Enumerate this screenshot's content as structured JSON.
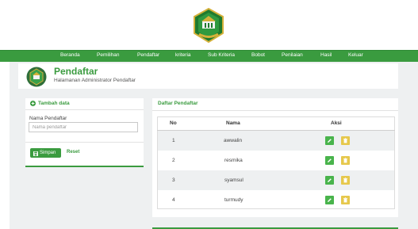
{
  "nav": {
    "items": [
      {
        "label": "Beranda"
      },
      {
        "label": "Pemilihan"
      },
      {
        "label": "Pendaftar"
      },
      {
        "label": "kriteria"
      },
      {
        "label": "Sub Kriteria"
      },
      {
        "label": "Bobot"
      },
      {
        "label": "Penilaian"
      },
      {
        "label": "Hasil"
      },
      {
        "label": "Keluar"
      }
    ]
  },
  "header": {
    "title": "Pendaftar",
    "subtitle": "Halamanan Administrator Pendaftar"
  },
  "form": {
    "heading": "Tambah data",
    "field_label": "Nama Pendaftar",
    "field_placeholder": "Nama pendaftar",
    "field_value": "",
    "save_label": "Simpan",
    "reset_label": "Reset"
  },
  "list": {
    "title": "Daftar Pendaftar",
    "columns": [
      "No",
      "Nama",
      "Aksi"
    ],
    "rows": [
      {
        "no": "1",
        "nama": "awwalin"
      },
      {
        "no": "2",
        "nama": "resmika"
      },
      {
        "no": "3",
        "nama": "syamsul"
      },
      {
        "no": "4",
        "nama": "turmudy"
      }
    ]
  },
  "icons": {
    "logo": "school-emblem-icon",
    "header": "school-emblem-icon",
    "add": "plus-circle-icon",
    "save": "floppy-disk-icon",
    "edit": "pencil-icon",
    "delete": "trash-icon"
  },
  "colors": {
    "primary": "#3a9b3f",
    "edit_button": "#49b44c",
    "delete_button": "#e6c84c",
    "content_bg": "#eef0f1"
  }
}
